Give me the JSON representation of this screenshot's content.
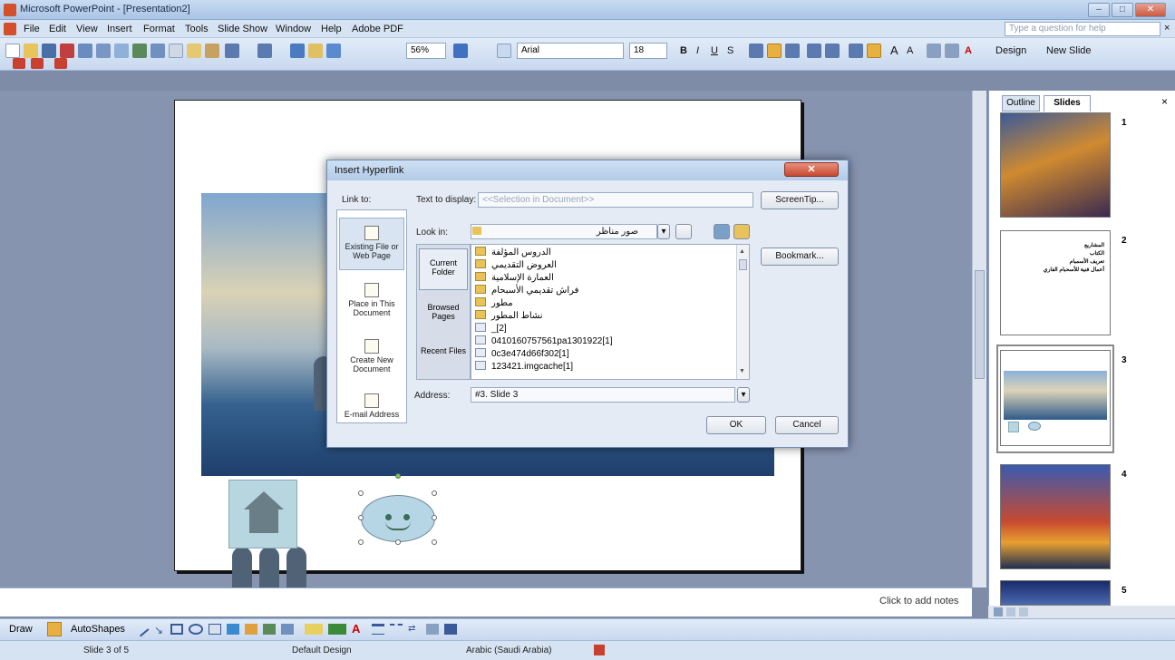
{
  "window": {
    "title": "Microsoft PowerPoint - [Presentation2]"
  },
  "menu": {
    "items": [
      "File",
      "Edit",
      "View",
      "Insert",
      "Format",
      "Tools",
      "Slide Show",
      "Window",
      "Help",
      "Adobe PDF"
    ],
    "question_placeholder": "Type a question for help"
  },
  "toolbar": {
    "zoom": "56%",
    "font": "Arial",
    "font_size": "18",
    "design_label": "Design",
    "new_slide_label": "New Slide"
  },
  "dialog": {
    "title": "Insert Hyperlink",
    "link_to_label": "Link to:",
    "text_to_display_label": "Text to display:",
    "text_to_display_value": "<<Selection in Document>>",
    "screentip_button": "ScreenTip...",
    "look_in_label": "Look in:",
    "look_in_value": "صور مناظر",
    "bookmark_button": "Bookmark...",
    "link_to_items": [
      "Existing File or Web Page",
      "Place in This Document",
      "Create New Document",
      "E-mail Address"
    ],
    "nav_items": [
      "Current Folder",
      "Browsed Pages",
      "Recent Files"
    ],
    "files": [
      {
        "name": "الدروس المؤلفة",
        "type": "folder"
      },
      {
        "name": "العروض التقديمي",
        "type": "folder"
      },
      {
        "name": "العمارة الإسلامية",
        "type": "folder"
      },
      {
        "name": "فراش تقديمي الأسبحام",
        "type": "folder"
      },
      {
        "name": "مطور",
        "type": "folder"
      },
      {
        "name": "نشاط المطور",
        "type": "folder"
      },
      {
        "name": "_[2]",
        "type": "file"
      },
      {
        "name": "0410160757561pa1301922[1]",
        "type": "file"
      },
      {
        "name": "0c3e474d66f302[1]",
        "type": "file"
      },
      {
        "name": "123421.imgcache[1]",
        "type": "file"
      }
    ],
    "address_label": "Address:",
    "address_value": "#3. Slide 3",
    "ok_button": "OK",
    "cancel_button": "Cancel"
  },
  "slides_panel": {
    "outline_tab": "Outline",
    "slides_tab": "Slides",
    "thumbnails": [
      "1",
      "2",
      "3",
      "4",
      "5"
    ],
    "slide2_lines": [
      "المشاريع",
      "الكتاب",
      "تعريف الأسمبام",
      "أعمال فنية للأسحبام الفاري"
    ]
  },
  "notes": {
    "placeholder": "Click to add notes"
  },
  "drawing": {
    "draw_label": "Draw",
    "autoshapes_label": "AutoShapes"
  },
  "status": {
    "slide": "Slide 3 of 5",
    "design": "Default Design",
    "language": "Arabic (Saudi Arabia)"
  }
}
